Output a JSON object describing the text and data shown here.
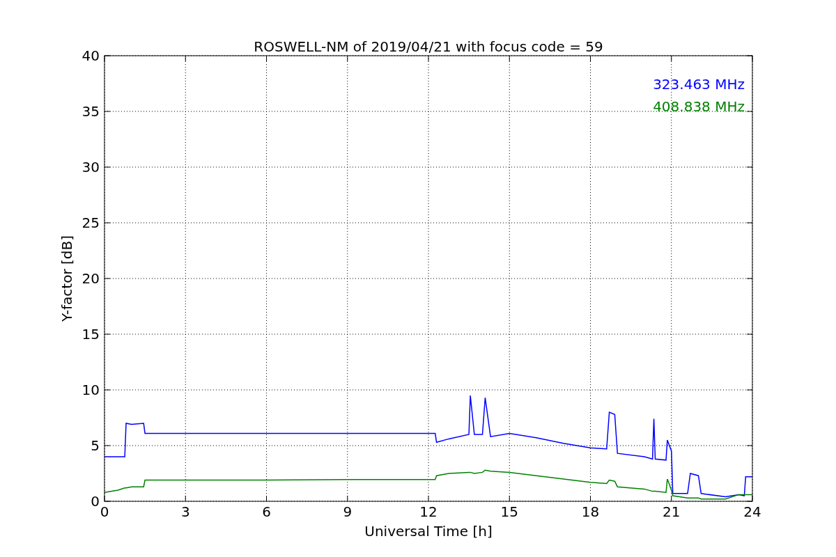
{
  "figure": {
    "chart_data": {
      "type": "line",
      "title": "ROSWELL-NM of 2019/04/21 with focus code = 59",
      "xlabel": "Universal Time [h]",
      "ylabel": "Y-factor [dB]",
      "x": [
        0,
        0.5,
        0.75,
        0.8,
        1,
        1.45,
        1.5,
        3,
        6,
        9,
        12.25,
        12.3,
        12.75,
        13.5,
        13.55,
        13.7,
        14,
        14.1,
        14.3,
        15,
        16,
        17,
        18,
        18.6,
        18.7,
        18.9,
        19,
        20,
        20.3,
        20.35,
        20.4,
        20.8,
        20.85,
        21,
        21.05,
        21.6,
        21.7,
        22,
        22.1,
        23,
        23.5,
        23.7,
        23.75,
        24
      ],
      "series": [
        {
          "name": "323.463 MHz",
          "color": "#0000ff",
          "values": [
            4.0,
            4.0,
            4.0,
            7.0,
            6.9,
            7.0,
            6.1,
            6.1,
            6.1,
            6.1,
            6.1,
            5.3,
            5.6,
            6.0,
            9.5,
            6.0,
            6.0,
            9.3,
            5.8,
            6.1,
            5.7,
            5.2,
            4.8,
            4.7,
            8.0,
            7.8,
            4.3,
            4.0,
            3.8,
            7.4,
            3.8,
            3.7,
            5.5,
            4.5,
            0.7,
            0.7,
            2.5,
            2.3,
            0.7,
            0.4,
            0.6,
            0.5,
            2.2,
            2.2
          ]
        },
        {
          "name": "408.838 MHz",
          "color": "#008000",
          "values": [
            0.8,
            1.0,
            1.2,
            1.2,
            1.3,
            1.3,
            1.9,
            1.9,
            1.9,
            1.95,
            1.95,
            2.3,
            2.5,
            2.6,
            2.6,
            2.5,
            2.6,
            2.8,
            2.7,
            2.6,
            2.3,
            2.0,
            1.7,
            1.6,
            1.9,
            1.8,
            1.3,
            1.1,
            0.9,
            0.9,
            0.9,
            0.8,
            2.0,
            1.0,
            0.5,
            0.3,
            0.3,
            0.3,
            0.2,
            0.2,
            0.6,
            0.6,
            0.6,
            0.6
          ]
        }
      ],
      "xlim": [
        0,
        24
      ],
      "ylim": [
        0,
        40
      ],
      "xticks": [
        0,
        3,
        6,
        9,
        12,
        15,
        18,
        21,
        24
      ],
      "yticks": [
        0,
        5,
        10,
        15,
        20,
        25,
        30,
        35,
        40
      ],
      "grid": true
    }
  }
}
